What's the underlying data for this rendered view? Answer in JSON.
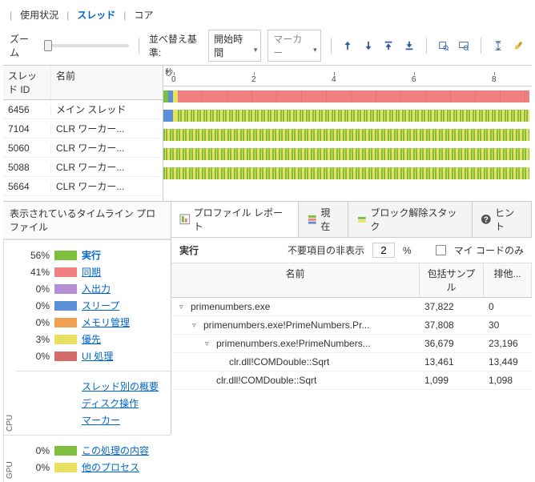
{
  "tabs": {
    "usage": "使用状況",
    "threads": "スレッド",
    "cores": "コア"
  },
  "toolbar": {
    "zoom": "ズーム",
    "sort_label": "並べ替え基準:",
    "sort_value": "開始時間",
    "marker": "マーカー"
  },
  "ruler": {
    "unit": "秒",
    "ticks": [
      "0",
      "2",
      "4",
      "6",
      "8"
    ]
  },
  "thread_header": {
    "id": "スレッド ID",
    "name": "名前"
  },
  "threads": [
    {
      "id": "6456",
      "name": "メイン スレッド"
    },
    {
      "id": "7104",
      "name": "CLR ワーカー..."
    },
    {
      "id": "5060",
      "name": "CLR ワーカー..."
    },
    {
      "id": "5088",
      "name": "CLR ワーカー..."
    },
    {
      "id": "5664",
      "name": "CLR ワーカー..."
    }
  ],
  "profile": {
    "title": "表示されているタイムライン プロファイル",
    "cpu_label": "CPU",
    "gpu_label": "GPU",
    "items": [
      {
        "pct": "56%",
        "color": "#7fbf3f",
        "label": "実行",
        "bold": true
      },
      {
        "pct": "41%",
        "color": "#f08080",
        "label": "同期"
      },
      {
        "pct": "0%",
        "color": "#b58ed6",
        "label": "入出力"
      },
      {
        "pct": "0%",
        "color": "#5b8fd6",
        "label": "スリープ"
      },
      {
        "pct": "0%",
        "color": "#f0a050",
        "label": "メモリ管理"
      },
      {
        "pct": "3%",
        "color": "#e8e060",
        "label": "優先"
      },
      {
        "pct": "0%",
        "color": "#d66b6b",
        "label": "UI 処理"
      }
    ],
    "links": [
      "スレッド別の概要",
      "ディスク操作",
      "マーカー"
    ],
    "gpu_items": [
      {
        "pct": "0%",
        "color": "#7fbf3f",
        "label": "この処理の内容"
      },
      {
        "pct": "0%",
        "color": "#e8e060",
        "label": "他のプロセス"
      }
    ]
  },
  "report": {
    "tabs": {
      "profile": "プロファイル レポート",
      "current": "現在",
      "unblock": "ブロック解除スタック",
      "hint": "ヒント"
    },
    "title": "実行",
    "noise_label": "不要項目の非表示",
    "noise_value": "2",
    "noise_pct": "%",
    "mycode": "マイ コードのみ",
    "cols": {
      "name": "名前",
      "inc": "包括サンプル",
      "exc": "排他..."
    },
    "rows": [
      {
        "indent": 0,
        "toggle": "▿",
        "name": "primenumbers.exe",
        "inc": "37,822",
        "exc": "0"
      },
      {
        "indent": 1,
        "toggle": "▿",
        "name": "primenumbers.exe!PrimeNumbers.Pr...",
        "inc": "37,808",
        "exc": "30"
      },
      {
        "indent": 2,
        "toggle": "▿",
        "name": "primenumbers.exe!PrimeNumbers...",
        "inc": "36,679",
        "exc": "23,196"
      },
      {
        "indent": 3,
        "toggle": "",
        "name": "clr.dll!COMDouble::Sqrt",
        "inc": "13,461",
        "exc": "13,449"
      },
      {
        "indent": 2,
        "toggle": "",
        "name": "clr.dll!COMDouble::Sqrt",
        "inc": "1,099",
        "exc": "1,098"
      }
    ]
  },
  "colors": {
    "blue": "#5b8fd6",
    "green": "#7fbf3f",
    "yellow": "#e8e060",
    "red": "#f08080",
    "orange": "#f0a050",
    "purple": "#b58ed6"
  }
}
